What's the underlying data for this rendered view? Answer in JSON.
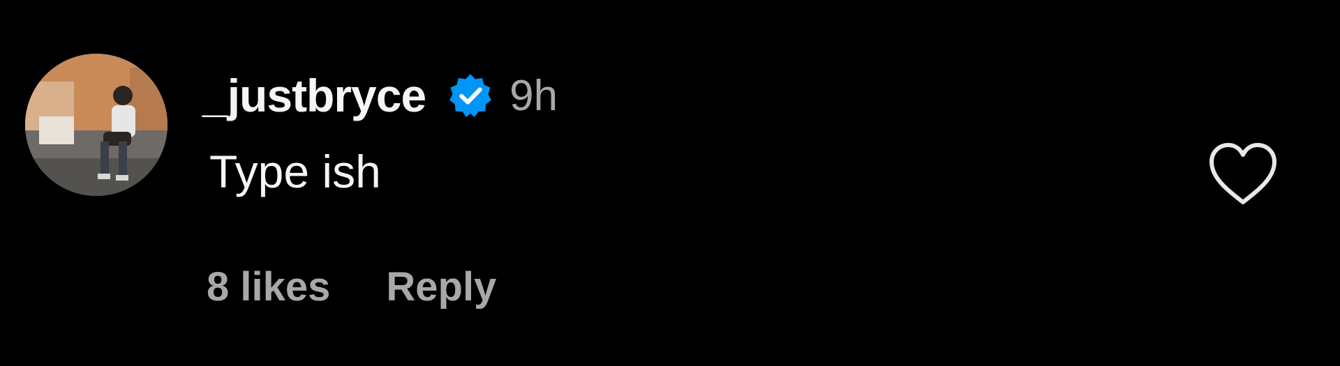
{
  "comment": {
    "username": "_justbryce",
    "verified": true,
    "timestamp": "9h",
    "text": "Type ish",
    "likes": "8 likes",
    "reply_label": "Reply",
    "avatar_icon": "user-avatar-photo",
    "like_icon": "heart-outline-icon"
  },
  "colors": {
    "background": "#000000",
    "primary_text": "#f5f5f5",
    "secondary_text": "#a8a8a8",
    "verified_badge": "#0095f6"
  }
}
